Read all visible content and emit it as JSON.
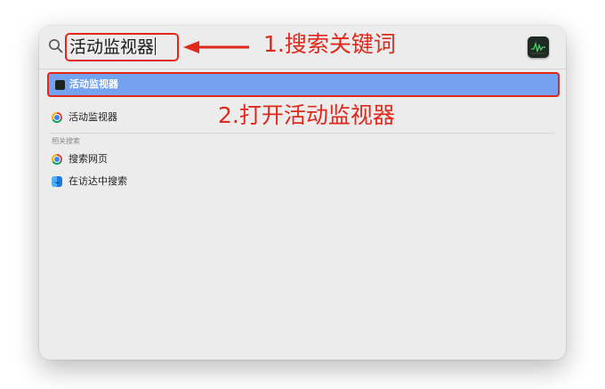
{
  "search": {
    "query": "活动监视器"
  },
  "annotations": {
    "step1": "1.搜索关键词",
    "step2": "2.打开活动监视器"
  },
  "results": {
    "top_hit": {
      "label": "活动监视器",
      "icon": "activity-monitor-icon",
      "selected": true
    },
    "web_result": {
      "label": "活动监视器",
      "icon": "chrome-icon"
    }
  },
  "related": {
    "title": "相关搜索",
    "items": [
      {
        "label": "搜索网页",
        "icon": "chrome-icon"
      },
      {
        "label": "在访达中搜索",
        "icon": "finder-icon"
      }
    ]
  },
  "colors": {
    "annotation": "#e0281b",
    "selection": "#74a2f0",
    "panel": "#ececec"
  }
}
